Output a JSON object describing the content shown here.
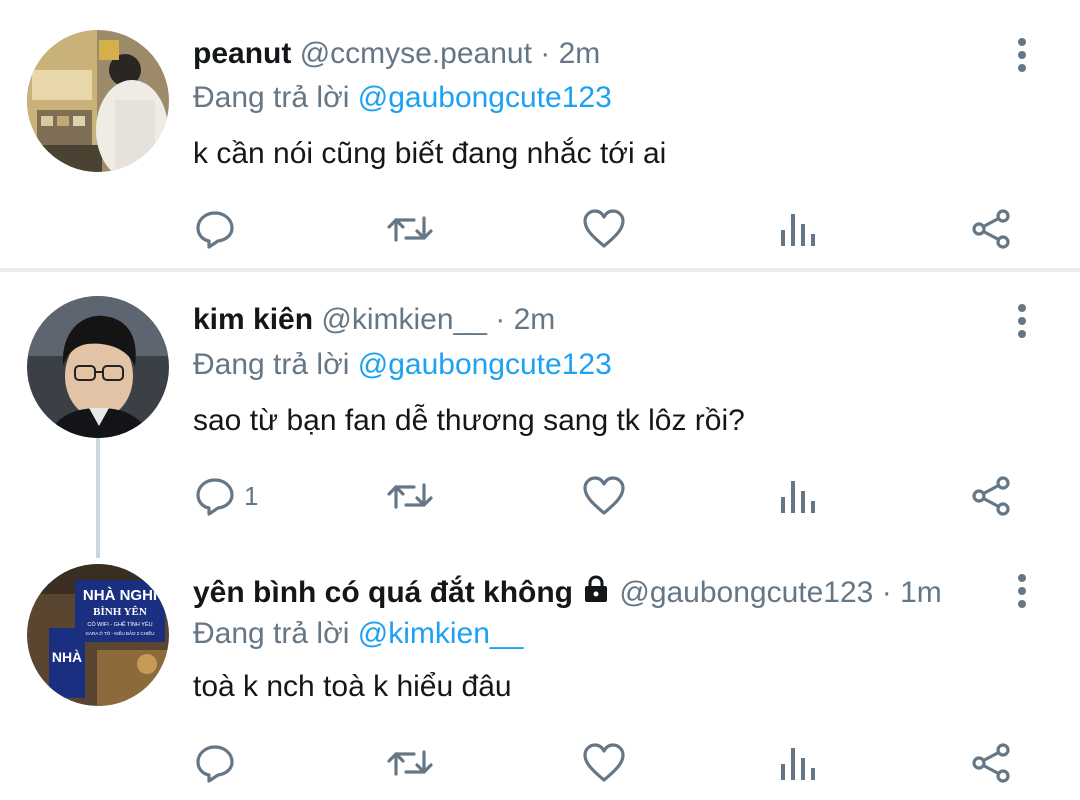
{
  "tweets": [
    {
      "name": "peanut",
      "handle": "@ccmyse.peanut",
      "separator": "·",
      "time": "2m",
      "replying_prefix": "Đang trả lời",
      "replying_to": "@gaubongcute123",
      "text": "k cần nói cũng biết đang nhắc tới ai",
      "reply_count": ""
    },
    {
      "name": "kim kiên",
      "handle": "@kimkien__",
      "separator": "·",
      "time": "2m",
      "replying_prefix": "Đang trả lời",
      "replying_to": "@gaubongcute123",
      "text": "sao từ bạn fan dễ thương sang tk lôz rồi?",
      "reply_count": "1"
    },
    {
      "name": "yên bình có quá đắt không",
      "handle": "@gaubongcute123",
      "separator": "·",
      "time": "1m",
      "replying_prefix": "Đang trả lời",
      "replying_to": "@kimkien__",
      "text": "toà k nch toà k hiểu đâu",
      "reply_count": "",
      "protected": true,
      "avatar_sign_lines": [
        "NHÀ NGHỈ",
        "BÌNH YÊN",
        "CÓ WIFI - GHẾ TÌNH YÊU",
        "GARA Ô TÔ - KIẾU BẢO 2 CHIỀU"
      ],
      "avatar_side_sign": "NHÀ"
    }
  ],
  "icons": {
    "reply": "reply-icon",
    "retweet": "retweet-icon",
    "like": "heart-icon",
    "analytics": "analytics-icon",
    "share": "share-icon",
    "more": "more-vertical-icon",
    "lock": "lock-icon"
  },
  "colors": {
    "text": "#14171a",
    "secondary": "#657786",
    "link": "#1da1f2",
    "divider": "#e6ecf0",
    "thread_line": "#ccd6dd"
  }
}
